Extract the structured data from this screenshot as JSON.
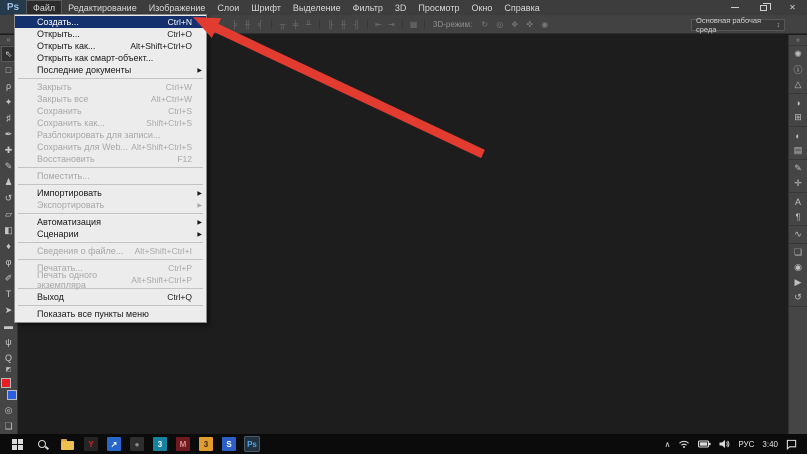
{
  "titlebar": {
    "logo": "Ps",
    "menus": [
      {
        "name": "file",
        "label": "Файл",
        "active": true
      },
      {
        "name": "edit",
        "label": "Редактирование",
        "active": false
      },
      {
        "name": "image",
        "label": "Изображение",
        "active": false
      },
      {
        "name": "layers",
        "label": "Слои",
        "active": false
      },
      {
        "name": "type",
        "label": "Шрифт",
        "active": false
      },
      {
        "name": "select",
        "label": "Выделение",
        "active": false
      },
      {
        "name": "filter",
        "label": "Фильтр",
        "active": false
      },
      {
        "name": "3d",
        "label": "3D",
        "active": false
      },
      {
        "name": "view",
        "label": "Просмотр",
        "active": false
      },
      {
        "name": "window",
        "label": "Окно",
        "active": false
      },
      {
        "name": "help",
        "label": "Справка",
        "active": false
      }
    ],
    "close_glyph": "✕"
  },
  "options_bar": {
    "icon_groups": [
      [
        "╞",
        "╫",
        "╡"
      ],
      [
        "╥",
        "╪",
        "╨"
      ],
      [
        "╟",
        "╫",
        "╢"
      ],
      [
        "⇤",
        "⇥"
      ],
      [
        "▦"
      ]
    ],
    "threed_label": "3D-режим:",
    "threed_icons": [
      "↻",
      "◎",
      "✥",
      "✜",
      "◉"
    ],
    "workspace_value": "Основная рабочая среда",
    "workspace_arrow": "↕"
  },
  "file_menu": {
    "items": [
      {
        "name": "new",
        "label": "Создать...",
        "shortcut": "Ctrl+N",
        "state": "highlighted"
      },
      {
        "name": "open",
        "label": "Открыть...",
        "shortcut": "Ctrl+O",
        "state": "enabled"
      },
      {
        "name": "open-as",
        "label": "Открыть как...",
        "shortcut": "Alt+Shift+Ctrl+O",
        "state": "enabled"
      },
      {
        "name": "open-smart-object",
        "label": "Открыть как смарт-объект...",
        "shortcut": "",
        "state": "enabled"
      },
      {
        "name": "recent-documents",
        "label": "Последние документы",
        "shortcut": "",
        "state": "enabled",
        "submenu": true
      },
      {
        "type": "separator"
      },
      {
        "name": "close",
        "label": "Закрыть",
        "shortcut": "Ctrl+W",
        "state": "disabled"
      },
      {
        "name": "close-all",
        "label": "Закрыть все",
        "shortcut": "Alt+Ctrl+W",
        "state": "disabled"
      },
      {
        "name": "save",
        "label": "Сохранить",
        "shortcut": "Ctrl+S",
        "state": "disabled"
      },
      {
        "name": "save-as",
        "label": "Сохранить как...",
        "shortcut": "Shift+Ctrl+S",
        "state": "disabled"
      },
      {
        "name": "unlock-for-editing",
        "label": "Разблокировать для записи...",
        "shortcut": "",
        "state": "disabled"
      },
      {
        "name": "save-for-web",
        "label": "Сохранить для Web...",
        "shortcut": "Alt+Shift+Ctrl+S",
        "state": "disabled"
      },
      {
        "name": "revert",
        "label": "Восстановить",
        "shortcut": "F12",
        "state": "disabled"
      },
      {
        "type": "separator"
      },
      {
        "name": "place",
        "label": "Поместить...",
        "shortcut": "",
        "state": "disabled"
      },
      {
        "type": "separator"
      },
      {
        "name": "import",
        "label": "Импортировать",
        "shortcut": "",
        "state": "enabled",
        "submenu": true
      },
      {
        "name": "export",
        "label": "Экспортировать",
        "shortcut": "",
        "state": "disabled",
        "submenu": true
      },
      {
        "type": "separator"
      },
      {
        "name": "automate",
        "label": "Автоматизация",
        "shortcut": "",
        "state": "enabled",
        "submenu": true
      },
      {
        "name": "scripts",
        "label": "Сценарии",
        "shortcut": "",
        "state": "enabled",
        "submenu": true
      },
      {
        "type": "separator"
      },
      {
        "name": "file-info",
        "label": "Сведения о файле...",
        "shortcut": "Alt+Shift+Ctrl+I",
        "state": "disabled"
      },
      {
        "type": "separator"
      },
      {
        "name": "print",
        "label": "Печатать...",
        "shortcut": "Ctrl+P",
        "state": "disabled"
      },
      {
        "name": "print-one-copy",
        "label": "Печать одного экземпляра",
        "shortcut": "Alt+Shift+Ctrl+P",
        "state": "disabled"
      },
      {
        "type": "separator"
      },
      {
        "name": "exit",
        "label": "Выход",
        "shortcut": "Ctrl+Q",
        "state": "enabled"
      },
      {
        "type": "separator"
      },
      {
        "name": "show-all-menu-items",
        "label": "Показать все пункты меню",
        "shortcut": "",
        "state": "enabled"
      }
    ]
  },
  "tool_panel": {
    "header_glyph": "»",
    "tools": [
      {
        "name": "move-tool",
        "glyph": "⇖",
        "selected": true
      },
      {
        "name": "marquee-tool",
        "glyph": "□",
        "selected": false
      },
      {
        "name": "lasso-tool",
        "glyph": "ρ",
        "selected": false
      },
      {
        "name": "magic-wand-tool",
        "glyph": "✦",
        "selected": false
      },
      {
        "name": "crop-tool",
        "glyph": "♯",
        "selected": false
      },
      {
        "name": "eyedropper-tool",
        "glyph": "✒",
        "selected": false
      },
      {
        "name": "healing-brush-tool",
        "glyph": "✚",
        "selected": false
      },
      {
        "name": "brush-tool",
        "glyph": "✎",
        "selected": false
      },
      {
        "name": "clone-stamp-tool",
        "glyph": "♟",
        "selected": false
      },
      {
        "name": "history-brush-tool",
        "glyph": "↺",
        "selected": false
      },
      {
        "name": "eraser-tool",
        "glyph": "▱",
        "selected": false
      },
      {
        "name": "gradient-tool",
        "glyph": "◧",
        "selected": false
      },
      {
        "name": "blur-tool",
        "glyph": "♦",
        "selected": false
      },
      {
        "name": "dodge-tool",
        "glyph": "φ",
        "selected": false
      },
      {
        "name": "pen-tool",
        "glyph": "✐",
        "selected": false
      },
      {
        "name": "type-tool",
        "glyph": "T",
        "selected": false
      },
      {
        "name": "path-selection-tool",
        "glyph": "➤",
        "selected": false
      },
      {
        "name": "shape-tool",
        "glyph": "▬",
        "selected": false
      },
      {
        "name": "hand-tool",
        "glyph": "ψ",
        "selected": false
      },
      {
        "name": "zoom-tool",
        "glyph": "Q",
        "selected": false
      }
    ],
    "foreground_color": "#e81c24",
    "background_color": "#2d5de0",
    "footer_tools": [
      {
        "name": "quick-mask-button",
        "glyph": "◎"
      },
      {
        "name": "screen-mode-button",
        "glyph": "❏"
      }
    ]
  },
  "right_dock": {
    "header_glyph": "«",
    "groups": [
      [
        {
          "name": "3d-panel-icon",
          "glyph": "✺"
        },
        {
          "name": "info-panel-icon",
          "glyph": "ⓘ"
        },
        {
          "name": "histogram-panel-icon",
          "glyph": "△"
        }
      ],
      [
        {
          "name": "color-panel-icon",
          "glyph": "◑"
        },
        {
          "name": "swatches-panel-icon",
          "glyph": "⊞"
        }
      ],
      [
        {
          "name": "adjustments-panel-icon",
          "glyph": "◐"
        },
        {
          "name": "layer-comps-panel-icon",
          "glyph": "▤"
        }
      ],
      [
        {
          "name": "brush-presets-panel-icon",
          "glyph": "✎"
        },
        {
          "name": "tool-presets-panel-icon",
          "glyph": "✛"
        }
      ],
      [
        {
          "name": "character-panel-icon",
          "glyph": "A"
        },
        {
          "name": "paragraph-panel-icon",
          "glyph": "¶"
        }
      ],
      [
        {
          "name": "character-styles-panel-icon",
          "glyph": "∿"
        }
      ],
      [
        {
          "name": "layers-panel-icon",
          "glyph": "❏"
        },
        {
          "name": "channels-panel-icon",
          "glyph": "◉"
        },
        {
          "name": "actions-panel-icon",
          "glyph": "▶"
        },
        {
          "name": "history-panel-icon",
          "glyph": "↺"
        }
      ]
    ]
  },
  "arrow": {
    "color": "#e23b30"
  },
  "taskbar": {
    "apps": [
      {
        "name": "yandex-browser-icon",
        "label": "Y",
        "bg": "#242424",
        "fg": "#e02020",
        "active": false
      },
      {
        "name": "app-icon-blue",
        "label": "↗",
        "bg": "#2667c9",
        "fg": "#ffffff",
        "active": false
      },
      {
        "name": "app-icon-dark",
        "label": "●",
        "bg": "#2e2e2e",
        "fg": "#8a8a8a",
        "active": false
      },
      {
        "name": "3dsmax-icon",
        "label": "3",
        "bg": "#17829d",
        "fg": "#ffffff",
        "active": false
      },
      {
        "name": "app-icon-red",
        "label": "М",
        "bg": "#6e1a1f",
        "fg": "#d98b8b",
        "active": false
      },
      {
        "name": "app-icon-orange",
        "label": "3",
        "bg": "#e09c2e",
        "fg": "#3a2a00",
        "active": false
      },
      {
        "name": "app-icon-s-blue",
        "label": "S",
        "bg": "#2b5fc7",
        "fg": "#ffffff",
        "active": false
      },
      {
        "name": "photoshop-taskbar-icon",
        "label": "Ps",
        "bg": "#0b2840",
        "fg": "#53a7e8",
        "active": true
      }
    ],
    "tray": {
      "chevron": "∧",
      "language": "РУС",
      "time": "3:40"
    }
  }
}
